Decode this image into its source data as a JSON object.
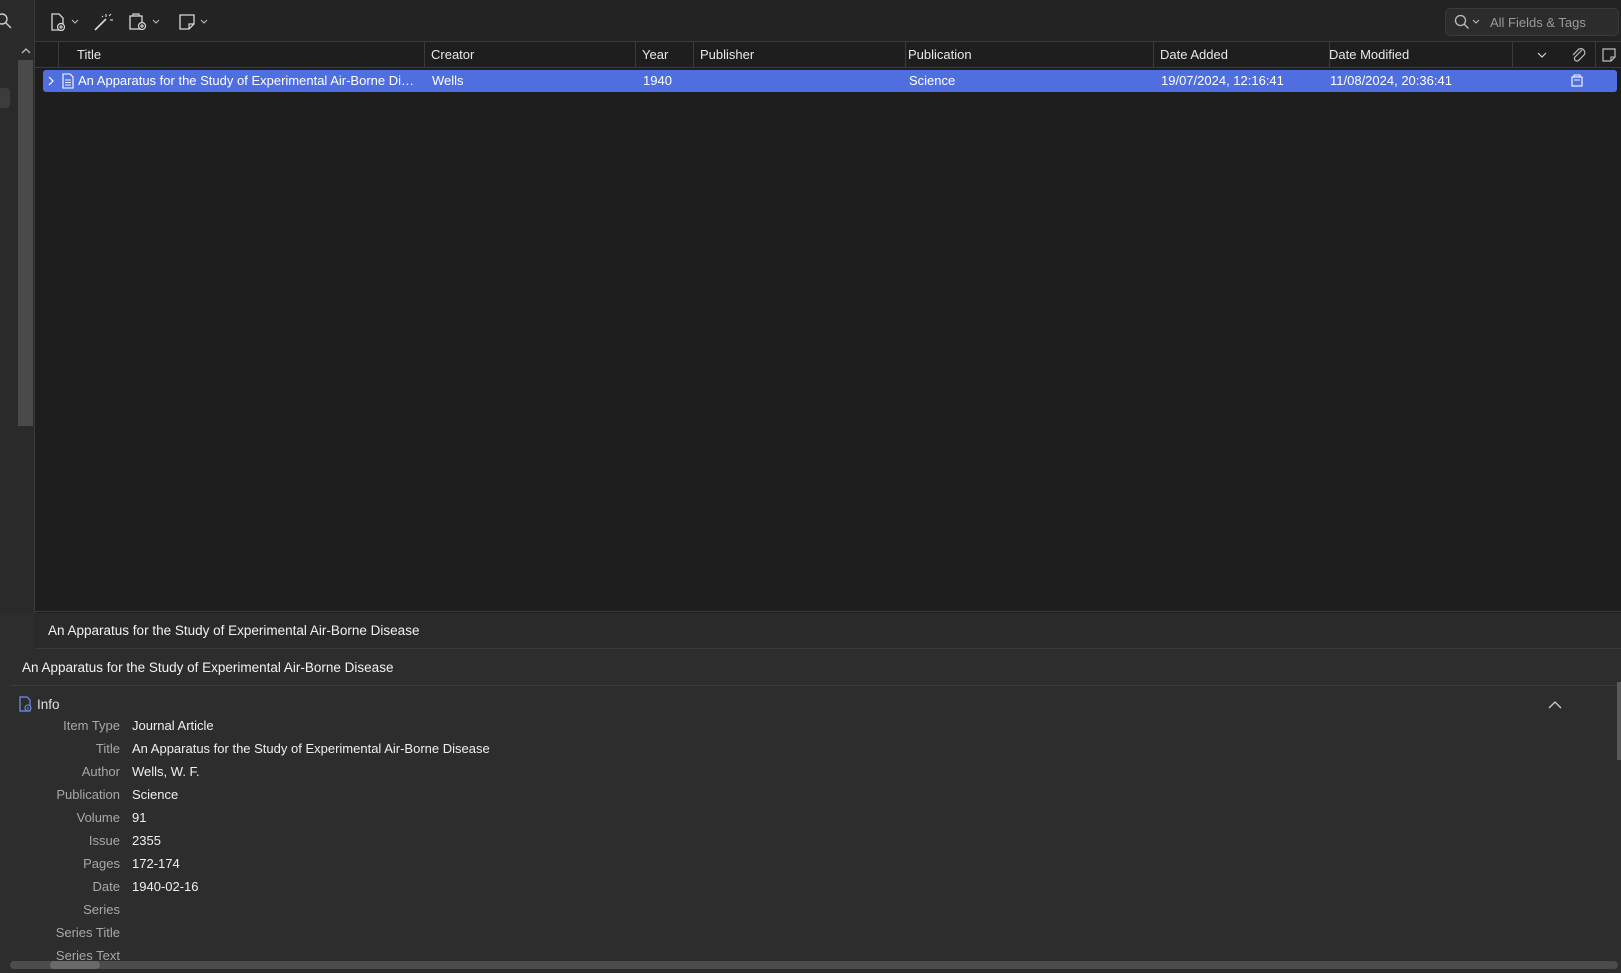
{
  "toolbar": {
    "new_item_icon": "new-item-icon",
    "magic_wand_icon": "add-by-identifier-icon",
    "attachment_icon": "add-attachment-icon",
    "note_icon": "new-note-icon",
    "search_placeholder": "All Fields & Tags"
  },
  "columns": [
    "Title",
    "Creator",
    "Year",
    "Publisher",
    "Publication",
    "Date Added",
    "Date Modified"
  ],
  "items": [
    {
      "title": "An Apparatus for the Study of Experimental Air-Borne Dis...",
      "creator": "Wells",
      "year": "1940",
      "publisher": "",
      "publication": "Science",
      "date_added": "19/07/2024, 12:16:41",
      "date_modified": "11/08/2024, 20:36:41"
    }
  ],
  "item_pane": {
    "header_title": "An Apparatus for the Study of Experimental Air-Borne Disease",
    "sub_title": "An Apparatus for the Study of Experimental Air-Borne Disease",
    "info_section": "Info",
    "fields": [
      {
        "label": "Item Type",
        "value": "Journal Article"
      },
      {
        "label": "Title",
        "value": "An Apparatus for the Study of Experimental Air-Borne Disease"
      },
      {
        "label": "Author",
        "value": "Wells, W. F."
      },
      {
        "label": "Publication",
        "value": "Science"
      },
      {
        "label": "Volume",
        "value": "91"
      },
      {
        "label": "Issue",
        "value": "2355"
      },
      {
        "label": "Pages",
        "value": "172-174"
      },
      {
        "label": "Date",
        "value": "1940-02-16"
      },
      {
        "label": "Series",
        "value": ""
      },
      {
        "label": "Series Title",
        "value": ""
      },
      {
        "label": "Series Text",
        "value": ""
      }
    ]
  },
  "colors": {
    "selection": "#4f6fe0",
    "background": "#1e1e1e",
    "pane": "#2d2d2d"
  }
}
